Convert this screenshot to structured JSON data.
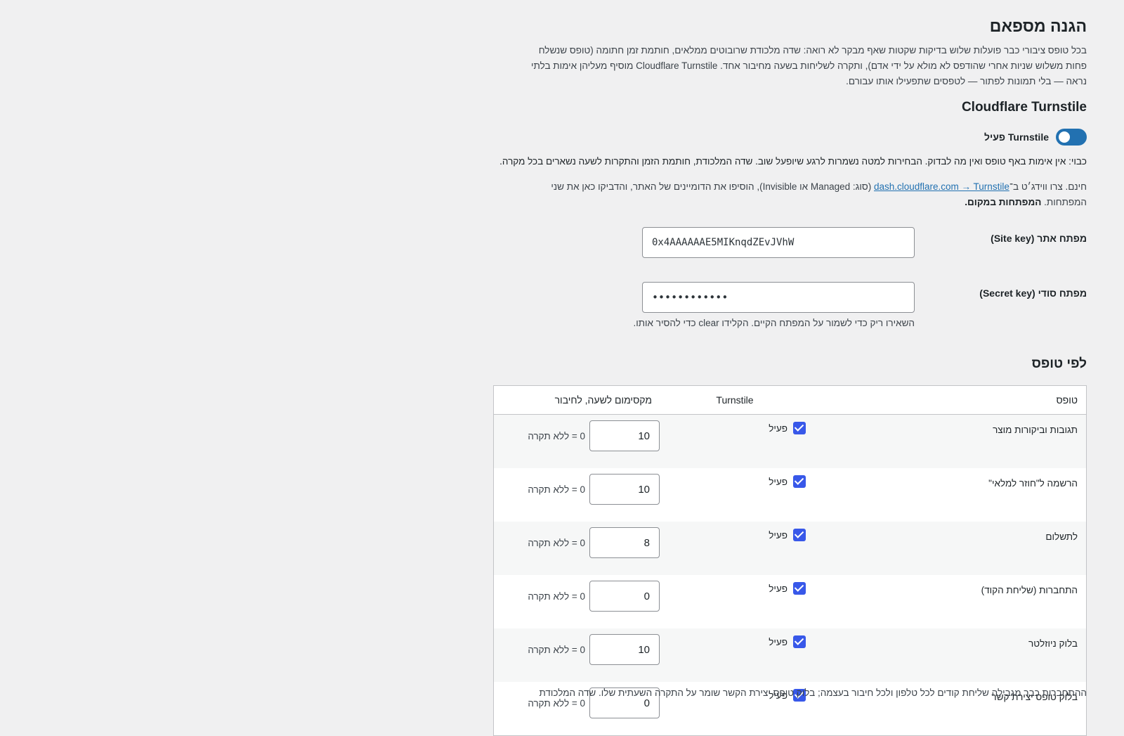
{
  "page": {
    "title": "הגנה מספאם",
    "intro": "בכל טופס ציבורי כבר פועלות שלוש בדיקות שקטות שאף מבקר לא רואה: שדה מלכודת שרובוטים ממלאים, חותמת זמן חתומה (טופס שנשלח פחות משלוש שניות אחרי שהודפס לא מולא על ידי אדם), ותקרה לשליחות בשעה מחיבור אחד. Cloudflare Turnstile מוסיף מעליהן אימות בלתי נראה — בלי תמונות לפתור — לטפסים שתפעילו אותו עבורם."
  },
  "turnstile": {
    "heading": "Cloudflare Turnstile",
    "toggle_label": "Turnstile פעיל",
    "toggle_on": true,
    "off_note": "כבוי: אין אימות באף טופס ואין מה לבדוק. הבחירות למטה נשמרות לרגע שיופעל שוב. שדה המלכודת, חותמת הזמן והתקרות לשעה נשארים בכל מקרה.",
    "free_pre": "חינם. צרו ווידג׳ט ב־",
    "free_link": "dash.cloudflare.com → Turnstile",
    "free_post": " (סוג: Managed או Invisible), הוסיפו את הדומיינים של האתר, והדביקו כאן את שני המפתחות. ",
    "free_bold": "המפתחות במקום.",
    "site_key_label": "מפתח אתר (Site key)",
    "site_key_value": "0x4AAAAAAE5MIKnqdZEvJVhW",
    "secret_key_label": "מפתח סודי (Secret key)",
    "secret_key_value": "••••••••••••",
    "secret_help": "השאירו ריק כדי לשמור על המפתח הקיים. הקלידו clear כדי להסיר אותו."
  },
  "per_form": {
    "heading": "לפי טופס",
    "columns": {
      "form": "טופס",
      "turnstile": "Turnstile",
      "cap": "מקסימום לשעה, לחיבור"
    },
    "active_label": "פעיל",
    "cap_help": "0 = ללא תקרה",
    "rows": [
      {
        "form": "תגובות וביקורות מוצר",
        "active": true,
        "cap": "10"
      },
      {
        "form": "הרשמה ל\"חוזר למלאי\"",
        "active": true,
        "cap": "10"
      },
      {
        "form": "לתשלום",
        "active": true,
        "cap": "8"
      },
      {
        "form": "התחברות (שליחת הקוד)",
        "active": true,
        "cap": "0"
      },
      {
        "form": "בלוק ניוזלטר",
        "active": true,
        "cap": "10"
      },
      {
        "form": "בלוק טופס יצירת קשר",
        "active": true,
        "cap": "0"
      }
    ],
    "footer_note": "ההתחברות כבר מגבילה שליחת קודים לכל טלפון ולכל חיבור בעצמה; בלוק טופס יצירת הקשר שומר על התקרה השעתית שלו. שדה המלכודת"
  }
}
